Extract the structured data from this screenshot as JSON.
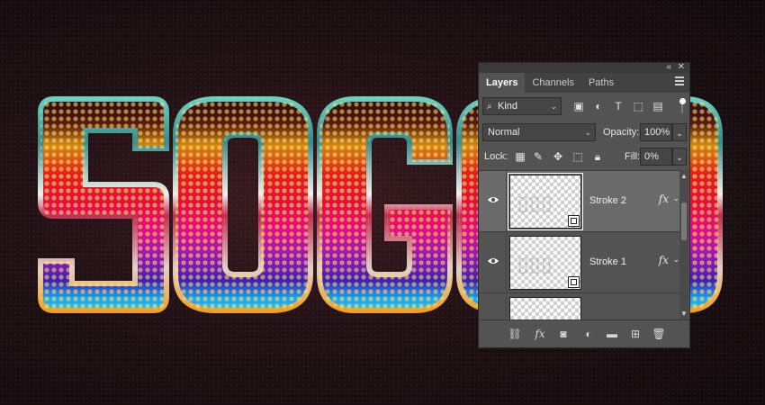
{
  "artwork": {
    "visible_text": "SOGO"
  },
  "panel": {
    "tabs": [
      {
        "label": "Layers",
        "active": true
      },
      {
        "label": "Channels",
        "active": false
      },
      {
        "label": "Paths",
        "active": false
      }
    ],
    "filter": {
      "kind_label": "Kind",
      "icons": [
        "image-filter-icon",
        "adjustment-filter-icon",
        "type-filter-icon",
        "shape-filter-icon",
        "smart-object-filter-icon"
      ]
    },
    "blend_mode": "Normal",
    "opacity": {
      "label": "Opacity:",
      "value": "100%"
    },
    "lock": {
      "label": "Lock:",
      "icons": [
        "lock-transparent-icon",
        "lock-image-icon",
        "lock-position-icon",
        "lock-artboard-icon",
        "lock-all-icon"
      ]
    },
    "fill": {
      "label": "Fill:",
      "value": "0%"
    },
    "layers": [
      {
        "name": "Stroke 2",
        "selected": true,
        "visible": true,
        "fx": "fx"
      },
      {
        "name": "Stroke 1",
        "selected": false,
        "visible": true,
        "fx": "fx"
      }
    ],
    "bottom_icons": [
      "link-layers-icon",
      "fx-icon",
      "layer-mask-icon",
      "adjustment-layer-icon",
      "new-group-icon",
      "new-layer-icon",
      "trash-icon"
    ]
  },
  "colors": {
    "panel_bg": "#535353",
    "selected_row": "#6a6a6a",
    "canvas_bg": "#1c0f12"
  }
}
